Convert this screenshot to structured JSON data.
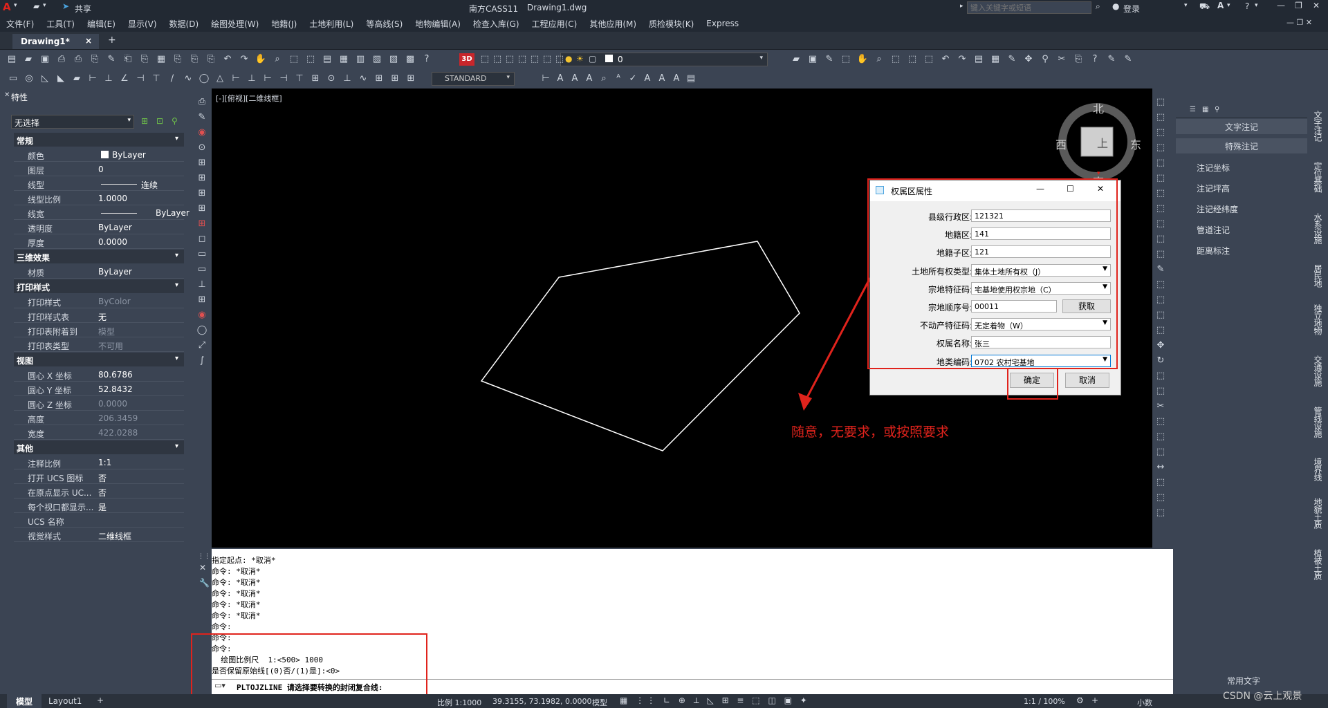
{
  "titlebar": {
    "app_title": "南方CASS11",
    "doc_title": "Drawing1.dwg",
    "share_label": "共享",
    "search_placeholder": "键入关键字或短语",
    "login_label": "登录"
  },
  "menus": [
    "文件(F)",
    "工具(T)",
    "编辑(E)",
    "显示(V)",
    "数据(D)",
    "绘图处理(W)",
    "地籍(J)",
    "土地利用(L)",
    "等高线(S)",
    "地物编辑(A)",
    "检查入库(G)",
    "工程应用(C)",
    "其他应用(M)",
    "质检模块(K)",
    "Express"
  ],
  "tabs": {
    "doc_tab": "Drawing1*",
    "close": "×",
    "add": "+"
  },
  "toolbar": {
    "layer_value": "0",
    "text_style": "STANDARD",
    "badge_3d": "3D"
  },
  "properties": {
    "title": "特性",
    "selection": "无选择",
    "sections": [
      {
        "name": "常规",
        "rows": [
          [
            "颜色",
            "ByLayer"
          ],
          [
            "图层",
            "0"
          ],
          [
            "线型",
            "连续"
          ],
          [
            "线型比例",
            "1.0000"
          ],
          [
            "线宽",
            "ByLayer"
          ],
          [
            "透明度",
            "ByLayer"
          ],
          [
            "厚度",
            "0.0000"
          ]
        ]
      },
      {
        "name": "三维效果",
        "rows": [
          [
            "材质",
            "ByLayer"
          ]
        ]
      },
      {
        "name": "打印样式",
        "rows": [
          [
            "打印样式",
            "ByColor"
          ],
          [
            "打印样式表",
            "无"
          ],
          [
            "打印表附着到",
            "模型"
          ],
          [
            "打印表类型",
            "不可用"
          ]
        ]
      },
      {
        "name": "视图",
        "rows": [
          [
            "圆心 X 坐标",
            "80.6786"
          ],
          [
            "圆心 Y 坐标",
            "52.8432"
          ],
          [
            "圆心 Z 坐标",
            "0.0000"
          ],
          [
            "高度",
            "206.3459"
          ],
          [
            "宽度",
            "422.0288"
          ]
        ]
      },
      {
        "name": "其他",
        "rows": [
          [
            "注释比例",
            "1:1"
          ],
          [
            "打开 UCS 图标",
            "否"
          ],
          [
            "在原点显示 UC...",
            "否"
          ],
          [
            "每个视口都显示...",
            "是"
          ],
          [
            "UCS 名称",
            ""
          ],
          [
            "视觉样式",
            "二维线框"
          ]
        ]
      }
    ]
  },
  "canvas": {
    "viewport_label": "[-][俯视][二维线框]",
    "compass": {
      "north": "北",
      "south": "南",
      "east": "东",
      "west": "西",
      "top": "上"
    },
    "annotation": "随意，无要求，或按照要求"
  },
  "dialog": {
    "title": "权属区属性",
    "fields": [
      {
        "label": "县级行政区:",
        "value": "121321",
        "type": "text"
      },
      {
        "label": "地籍区:",
        "value": "141",
        "type": "text"
      },
      {
        "label": "地籍子区:",
        "value": "121",
        "type": "text"
      },
      {
        "label": "土地所有权类型:",
        "value": "集体土地所有权（J）",
        "type": "select"
      },
      {
        "label": "宗地特征码:",
        "value": "宅基地使用权宗地（C）",
        "type": "select"
      },
      {
        "label": "宗地顺序号:",
        "value": "00011",
        "type": "text_button",
        "button": "获取"
      },
      {
        "label": "不动产特征码:",
        "value": "无定着物（W）",
        "type": "select"
      },
      {
        "label": "权属名称:",
        "value": "张三",
        "type": "text"
      },
      {
        "label": "地类编码:",
        "value": "0702 农村宅基地",
        "type": "select"
      }
    ],
    "ok_label": "确定",
    "cancel_label": "取消"
  },
  "command": {
    "history": [
      "指定起点: *取消*",
      "命令: *取消*",
      "命令: *取消*",
      "命令: *取消*",
      "命令: *取消*",
      "命令: *取消*",
      "命令:",
      "命令:",
      "命令:",
      "  绘图比例尺  1:<500> 1000",
      "是否保留原始线[(0)否/(1)是]:<0>"
    ],
    "prompt": "PLTOJZLINE 请选择要转换的封闭复合线:"
  },
  "annotation_panel": {
    "tabs": [
      "文字注记",
      "特殊注记"
    ],
    "items": [
      "注记坐标",
      "注记坪高",
      "注记经纬度",
      "管道注记",
      "距离标注"
    ],
    "footer": "常用文字"
  },
  "right_vtabs": [
    "文字注记",
    "定位基础",
    "水系设施",
    "居民地",
    "独立地物",
    "交通设施",
    "管线设施",
    "境界线",
    "地貌土质",
    "植被土质"
  ],
  "status": {
    "tabs": [
      "模型",
      "Layout1"
    ],
    "scale": "比例 1:1000",
    "coords": "39.3155, 73.1982, 0.0000",
    "model": "模型",
    "anno_scale": "1:1 / 100%",
    "units": "小数",
    "watermark": "CSDN @云上观景"
  },
  "colors": {
    "accent_red": "#e0231c",
    "dialog_title_accent": "#4aa3df"
  }
}
